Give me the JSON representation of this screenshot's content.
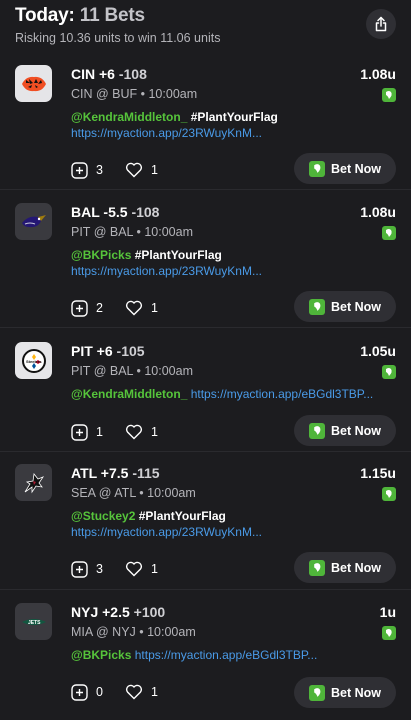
{
  "header": {
    "title_prefix": "Today:",
    "title_count": "11 Bets",
    "subtitle": "Risking 10.36 units to win 11.06 units"
  },
  "colors": {
    "background": "#1c1c1f",
    "mention": "#56c43b",
    "link": "#4a9be8",
    "book_green": "#4fb53a"
  },
  "bets": [
    {
      "team_logo": "bengals-logo",
      "pick": "CIN +6",
      "odds": "-108",
      "matchup": "CIN @ BUF • 10:00am",
      "units": "1.08u",
      "mention": "@KendraMiddleton_",
      "hashtag": "#PlantYourFlag",
      "link": "https://myaction.app/23RWuyKnM...",
      "comments": "3",
      "likes": "1",
      "bet_label": "Bet Now"
    },
    {
      "team_logo": "ravens-logo",
      "pick": "BAL -5.5",
      "odds": "-108",
      "matchup": "PIT @ BAL • 10:00am",
      "units": "1.08u",
      "mention": "@BKPicks",
      "hashtag": "#PlantYourFlag",
      "link": "https://myaction.app/23RWuyKnM...",
      "comments": "2",
      "likes": "1",
      "bet_label": "Bet Now"
    },
    {
      "team_logo": "steelers-logo",
      "pick": "PIT +6",
      "odds": "-105",
      "matchup": "PIT @ BAL • 10:00am",
      "units": "1.05u",
      "mention": "@KendraMiddleton_",
      "hashtag": "",
      "link": "https://myaction.app/eBGdl3TBP...",
      "comments": "1",
      "likes": "1",
      "bet_label": "Bet Now"
    },
    {
      "team_logo": "falcons-logo",
      "pick": "ATL +7.5",
      "odds": "-115",
      "matchup": "SEA @ ATL • 10:00am",
      "units": "1.15u",
      "mention": "@Stuckey2",
      "hashtag": "#PlantYourFlag",
      "link": "https://myaction.app/23RWuyKnM...",
      "comments": "3",
      "likes": "1",
      "bet_label": "Bet Now"
    },
    {
      "team_logo": "jets-logo",
      "pick": "NYJ +2.5",
      "odds": "+100",
      "matchup": "MIA @ NYJ • 10:00am",
      "units": "1u",
      "mention": "@BKPicks",
      "hashtag": "",
      "link": "https://myaction.app/eBGdl3TBP...",
      "comments": "0",
      "likes": "1",
      "bet_label": "Bet Now"
    }
  ]
}
